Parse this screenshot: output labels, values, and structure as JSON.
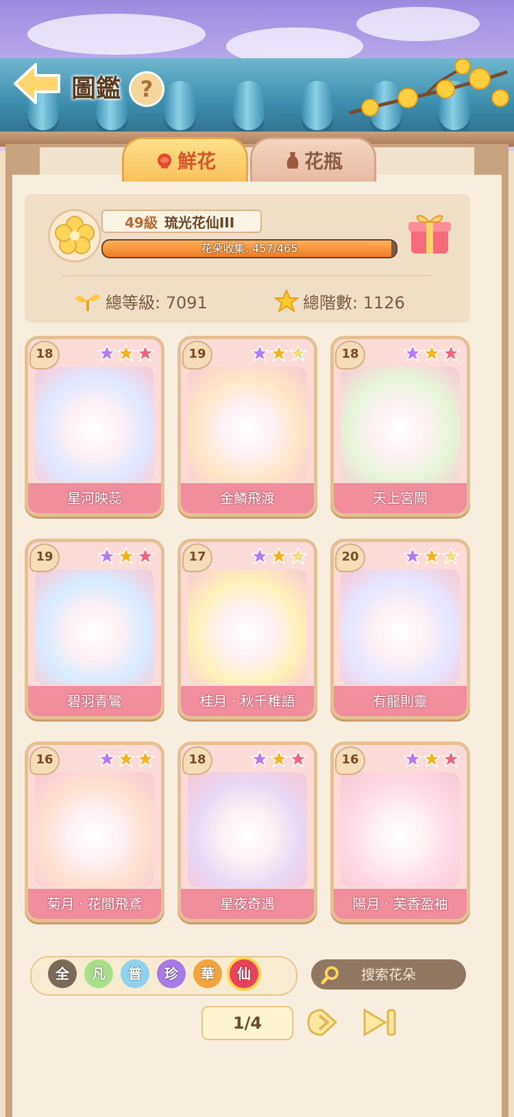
{
  "header": {
    "title": "圖鑑",
    "help_label": "?"
  },
  "tabs": [
    {
      "label": "鮮花",
      "active": true
    },
    {
      "label": "花瓶",
      "active": false
    }
  ],
  "profile": {
    "level": "49級",
    "rank_title": "琉光花仙III",
    "collection_label": "花朵收集: 457/465",
    "collection_progress": 0.983,
    "total_level_label": "總等級: 7091",
    "total_stars_label": "總階數: 1126"
  },
  "cards": [
    {
      "level": "18",
      "name": "星河映蕊",
      "stars": [
        "purple",
        "gold",
        "pink"
      ],
      "tint": "#dfe8ff"
    },
    {
      "level": "19",
      "name": "金鱗飛渡",
      "stars": [
        "purple",
        "gold",
        "rainbow"
      ],
      "tint": "#ffe6c4"
    },
    {
      "level": "18",
      "name": "天上宮闕",
      "stars": [
        "purple",
        "gold",
        "pink"
      ],
      "tint": "#e6f5d8"
    },
    {
      "level": "19",
      "name": "碧羽青鸞",
      "stars": [
        "purple",
        "gold",
        "pink"
      ],
      "tint": "#d7ebff"
    },
    {
      "level": "17",
      "name": "桂月 · 秋千稚語",
      "stars": [
        "purple",
        "gold",
        "rainbow"
      ],
      "tint": "#fff2b8"
    },
    {
      "level": "20",
      "name": "有龍則靈",
      "stars": [
        "purple",
        "gold",
        "rainbow"
      ],
      "tint": "#e4e6ff"
    },
    {
      "level": "16",
      "name": "菊月 · 花間飛鳶",
      "stars": [
        "purple",
        "gold",
        "gold"
      ],
      "tint": "#ffe0d0"
    },
    {
      "level": "18",
      "name": "星夜奇遇",
      "stars": [
        "purple",
        "gold",
        "pink"
      ],
      "tint": "#e7d8f5"
    },
    {
      "level": "16",
      "name": "陽月 · 芙香盈袖",
      "stars": [
        "purple",
        "gold",
        "pink"
      ],
      "tint": "#ffd9e6"
    }
  ],
  "filters": [
    {
      "label": "全",
      "color": "#7a6a5a"
    },
    {
      "label": "凡",
      "color": "#a8e08a"
    },
    {
      "label": "普",
      "color": "#8fd2ef"
    },
    {
      "label": "珍",
      "color": "#a77ae8"
    },
    {
      "label": "華",
      "color": "#f3a43c"
    },
    {
      "label": "仙",
      "color": "#e8435a"
    }
  ],
  "search": {
    "placeholder": "搜索花朵"
  },
  "pagination": {
    "label": "1/4"
  },
  "colors": {
    "star_purple": "#b27cf0",
    "star_gold": "#f6b41c",
    "star_pink": "#f2647e"
  }
}
